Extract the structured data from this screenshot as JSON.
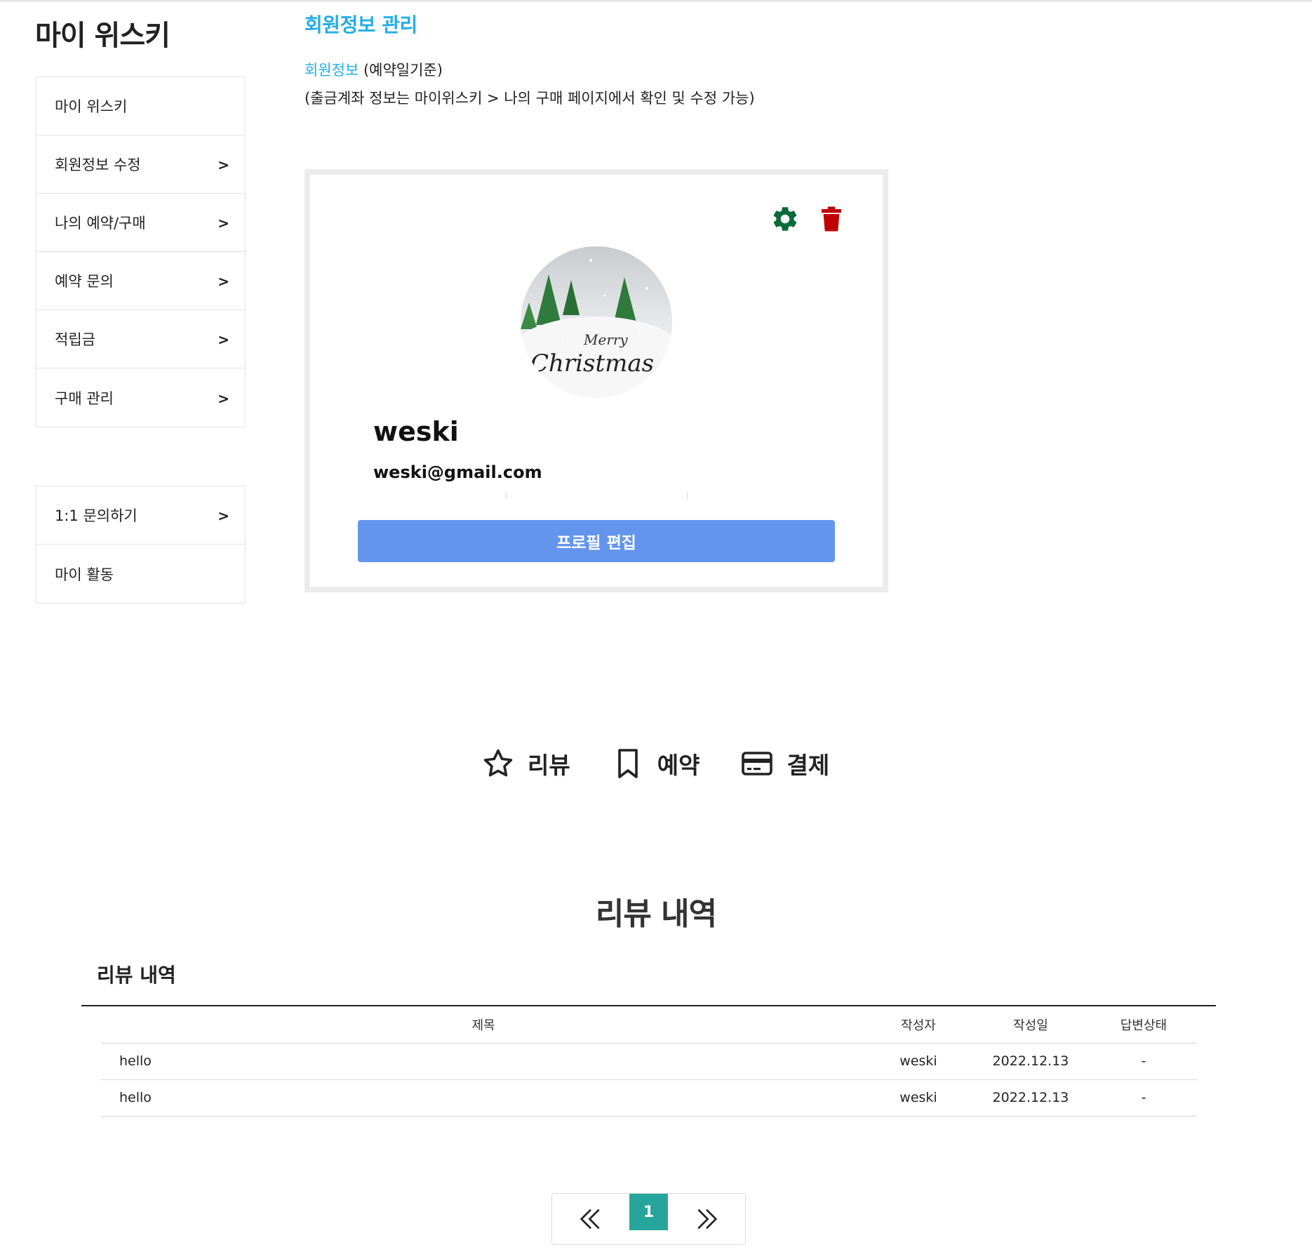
{
  "sidebar": {
    "title": "마이 위스키",
    "menu1": [
      {
        "label": "마이 위스키",
        "arrow": ""
      },
      {
        "label": "회원정보 수정",
        "arrow": ">"
      },
      {
        "label": "나의 예약/구매",
        "arrow": ">"
      },
      {
        "label": "예약 문의",
        "arrow": ">"
      },
      {
        "label": "적립금",
        "arrow": ">"
      },
      {
        "label": "구매 관리",
        "arrow": ">"
      }
    ],
    "menu2": [
      {
        "label": "1:1 문의하기",
        "arrow": ">"
      },
      {
        "label": "마이 활동",
        "arrow": ""
      }
    ]
  },
  "main": {
    "title": "회원정보 관리",
    "info_highlight": "회원정보",
    "info_rest": " (예약일기준)",
    "info_note": "(출금계좌 정보는 마이위스키 > 나의 구매 페이지에서 확인 및 수정 가능)"
  },
  "profile": {
    "avatar_text_line1": "Merry",
    "avatar_text_line2": "Christmas",
    "username": "weski",
    "email": "weski@gmail.com",
    "edit_button": "프로필 편집",
    "icons": {
      "settings": "gear-icon",
      "delete": "trash-icon"
    },
    "colors": {
      "settings": "#0b6b3a",
      "delete": "#c00000",
      "button": "#6495ed"
    }
  },
  "tabs": [
    {
      "label": "리뷰",
      "icon": "star-icon"
    },
    {
      "label": "예약",
      "icon": "bookmark-icon"
    },
    {
      "label": "결제",
      "icon": "credit-card-icon"
    }
  ],
  "reviews": {
    "section_title": "리뷰 내역",
    "sub_title": "리뷰 내역",
    "columns": [
      "제목",
      "작성자",
      "작성일",
      "답변상태"
    ],
    "rows": [
      [
        "hello",
        "weski",
        "2022.12.13",
        "-"
      ],
      [
        "hello",
        "weski",
        "2022.12.13",
        "-"
      ]
    ]
  },
  "pagination": {
    "current": "1",
    "prev_icon": "double-chevron-left-icon",
    "next_icon": "double-chevron-right-icon",
    "active_color": "#26a69a"
  }
}
